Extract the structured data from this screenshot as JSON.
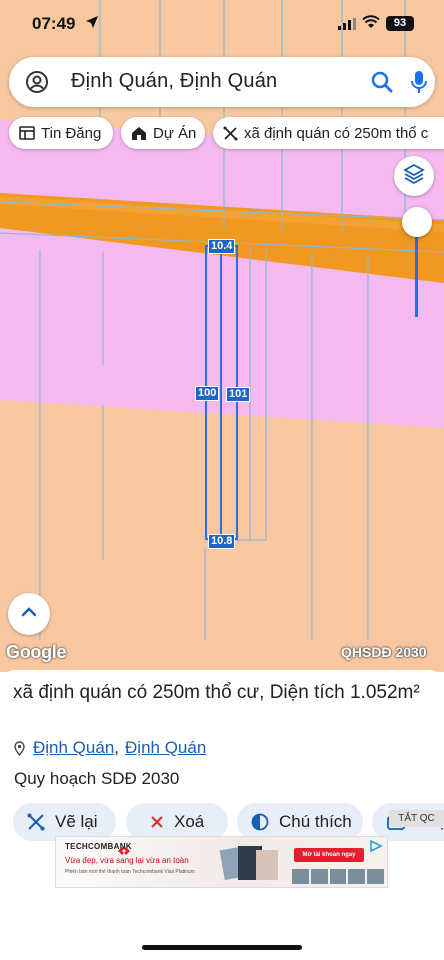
{
  "status_bar": {
    "time": "07:49",
    "battery": "93"
  },
  "search": {
    "query": "Định Quán, Định Quán"
  },
  "chips": [
    {
      "label": "Tin Đăng",
      "icon": "listing-icon"
    },
    {
      "label": "Dự Án",
      "icon": "house-icon"
    },
    {
      "label": "xã định quán có 250m thổ c",
      "icon": "ruler-icon"
    }
  ],
  "map": {
    "parcel_labels": {
      "top": "10.4",
      "left": "100",
      "right": "101",
      "bottom": "10.8"
    },
    "google_logo": "Google",
    "layer_label": "QHSDĐ 2030",
    "colors": {
      "residential": "#f7c8a0",
      "commercial": "#f5b8ee",
      "road": "#f39a2a",
      "parcel_outline": "#2d6ed8"
    }
  },
  "sheet": {
    "title": "xã định quán có 250m thổ cư, Diện tích 1.052m²",
    "location": {
      "ward": "Định Quán",
      "separator": ",",
      "district": "Định Quán"
    },
    "plan": "Quy hoạch SDĐ 2030",
    "actions": [
      {
        "label": "Vẽ lại",
        "icon": "redraw-icon"
      },
      {
        "label": "Xoá",
        "icon": "close-icon"
      },
      {
        "label": "Chú thích",
        "icon": "legend-icon"
      },
      {
        "label": "Chụp",
        "icon": "camera-icon"
      }
    ],
    "ad_badge": "TẮT QC"
  },
  "ad": {
    "brand": "TECHCOMBANK",
    "tagline": "Vừa đẹp, vừa sang lại vừa an toàn",
    "subline": "Phiên bản mới thẻ thanh toán Techcombank Visa Platinum",
    "cta": "Mở tài khoản ngay"
  }
}
